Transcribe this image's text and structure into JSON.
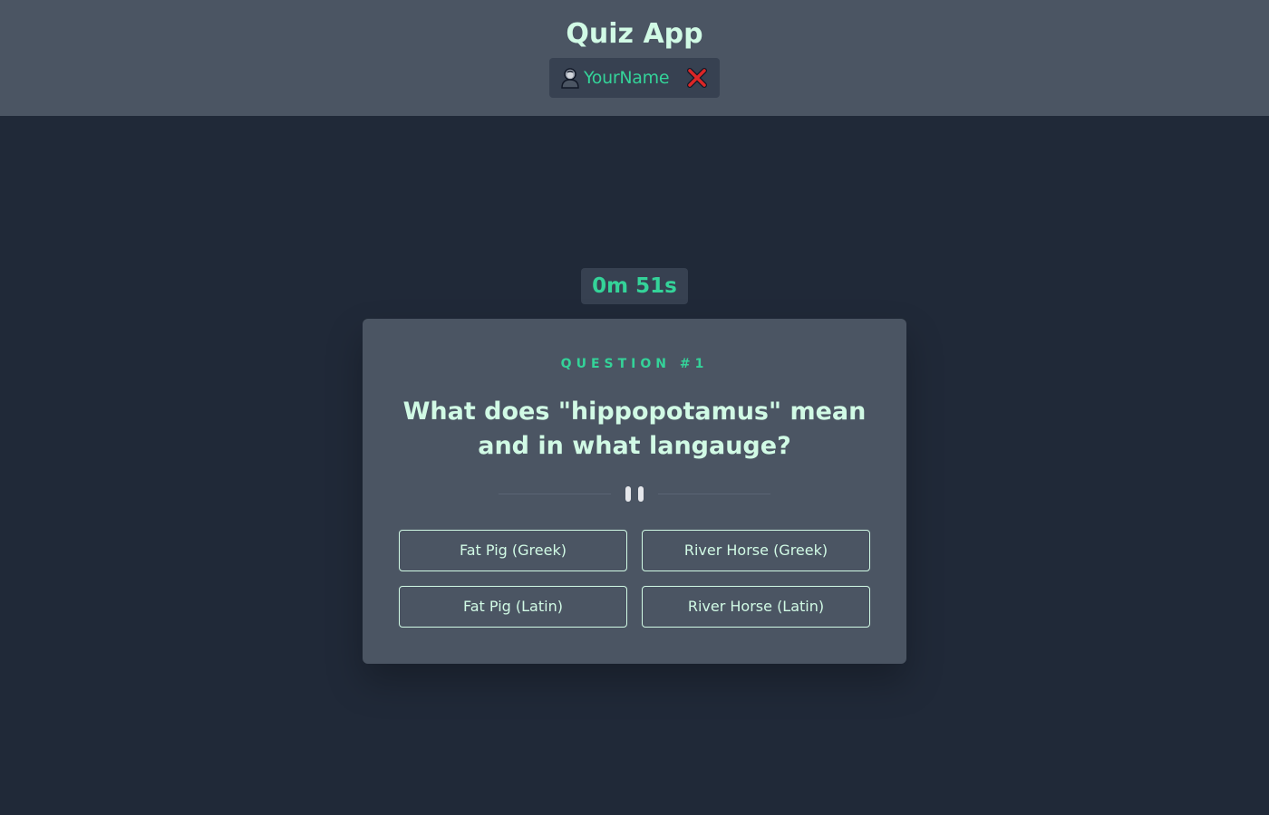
{
  "header": {
    "app_title": "Quiz App",
    "user_name": "YourName",
    "user_icon": "person-icon",
    "logout_icon": "close-icon"
  },
  "timer": {
    "text": "0m 51s"
  },
  "question": {
    "number_label": "QUESTION #1",
    "text": "What does \"hippopotamus\" mean and in what langauge?",
    "divider_icon": "pause-icon"
  },
  "answers": [
    {
      "label": "Fat Pig (Greek)"
    },
    {
      "label": "River Horse (Greek)"
    },
    {
      "label": "Fat Pig (Latin)"
    },
    {
      "label": "River Horse (Latin)"
    }
  ],
  "colors": {
    "background": "#202938",
    "header_bg": "#4b5563",
    "chip_bg": "#374151",
    "accent_green": "#34d399",
    "text_mint": "#d1fae5",
    "close_red": "#dc2626"
  }
}
